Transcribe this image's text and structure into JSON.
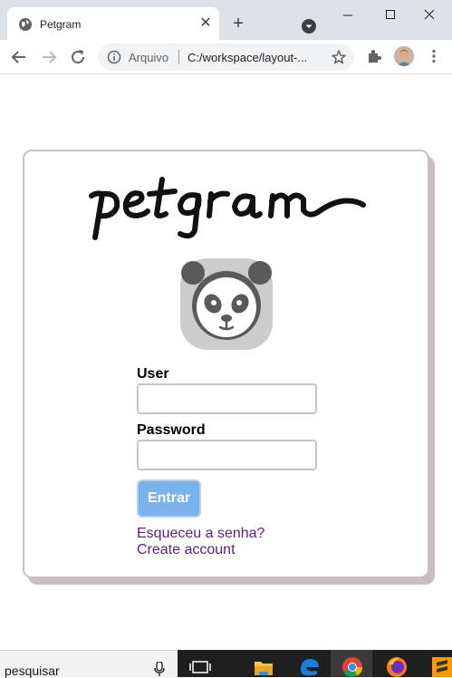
{
  "browser": {
    "tab_title": "Petgram",
    "tab_close": "✕",
    "new_tab": "+",
    "scheme_label": "Arquivo",
    "url": "C:/workspace/layout-..."
  },
  "page": {
    "logo_text": "petgram",
    "user_label": "User",
    "user_value": "",
    "password_label": "Password",
    "password_value": "",
    "submit_label": "Entrar",
    "forgot_link": "Esqueceu a senha?",
    "create_link": "Create account"
  },
  "taskbar": {
    "search_placeholder": "pesquisar",
    "apps": [
      "task-view-icon",
      "file-explorer-icon",
      "edge-icon",
      "chrome-icon",
      "firefox-icon",
      "sublime-icon"
    ]
  },
  "colors": {
    "tab_strip": "#dee1e6",
    "card_border": "#c9c1c4",
    "button_bg": "#7ab2ec",
    "link": "#5c237d"
  }
}
